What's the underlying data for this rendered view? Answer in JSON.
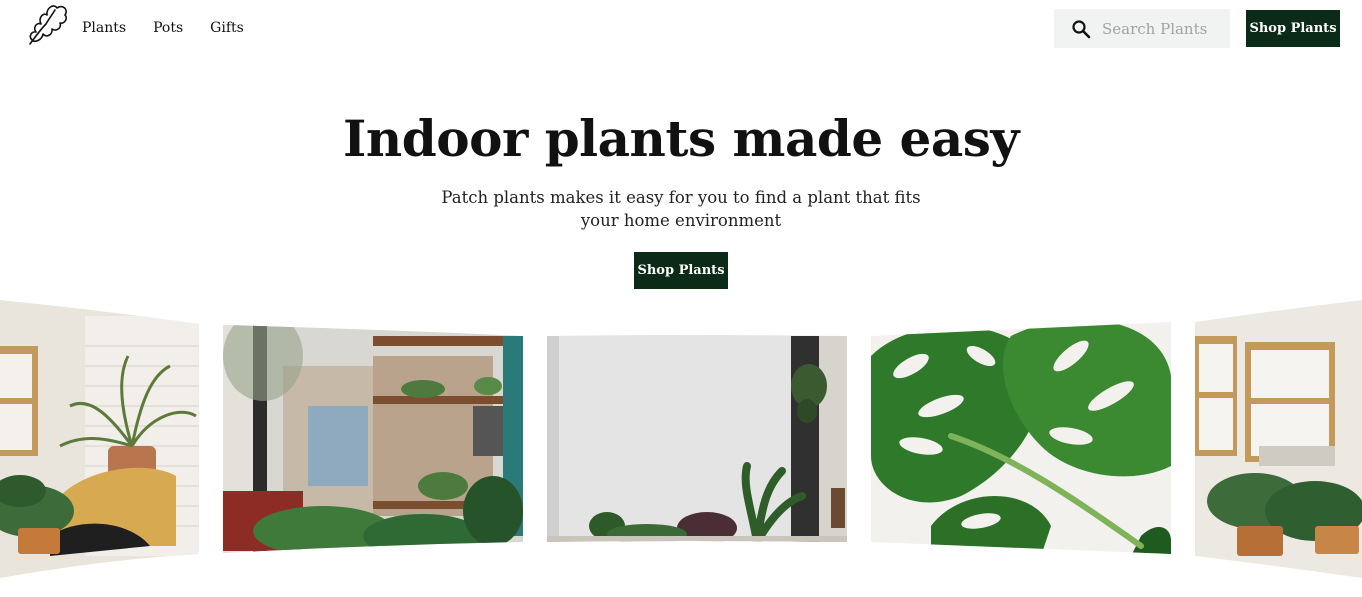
{
  "brand": {
    "logo_icon": "leaf-logo-icon"
  },
  "nav": {
    "items": [
      {
        "label": "Plants"
      },
      {
        "label": "Pots"
      },
      {
        "label": "Gifts"
      }
    ]
  },
  "search": {
    "placeholder": "Search Plants",
    "icon": "search-icon"
  },
  "header": {
    "cta_label": "Shop Plants"
  },
  "hero": {
    "title": "Indoor plants made easy",
    "subtitle": "Patch plants makes it easy for you to find a plant that fits your home environment",
    "cta_label": "Shop Plants"
  },
  "colors": {
    "accent": "#0b2a17",
    "search_bg": "#f1f2f2"
  },
  "gallery": {
    "images": [
      {
        "name": "living-room-chair-photo"
      },
      {
        "name": "cafe-shelf-plants-photo"
      },
      {
        "name": "white-wall-plants-photo"
      },
      {
        "name": "monstera-leaf-photo"
      },
      {
        "name": "window-plants-photo"
      }
    ]
  }
}
